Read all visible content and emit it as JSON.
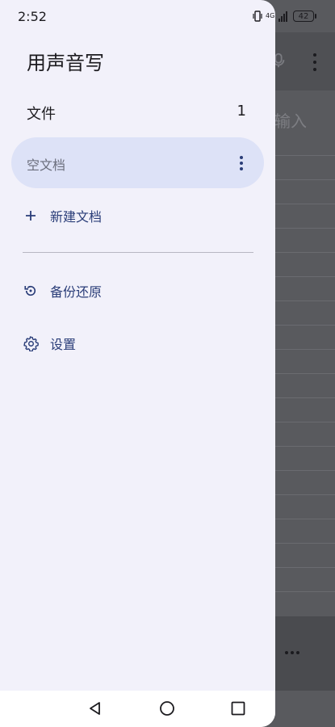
{
  "status_bar": {
    "time": "2:52",
    "battery": "42",
    "network": "4G"
  },
  "background_app": {
    "input_placeholder_fragment": "输入"
  },
  "drawer": {
    "app_title": "用声音写",
    "files_label": "文件",
    "files_count": "1",
    "documents": [
      {
        "label": "空文档"
      }
    ],
    "new_document_label": "新建文档",
    "backup_restore_label": "备份还原",
    "settings_label": "设置"
  },
  "icons": {
    "new_document": "plus-icon",
    "backup_restore": "restore-icon",
    "settings": "gear-icon",
    "document_menu": "more-vert-icon",
    "nav_back": "back-triangle-icon",
    "nav_home": "home-circle-icon",
    "nav_recent": "recent-square-icon"
  },
  "colors": {
    "drawer_bg": "#f2f1fa",
    "selected_item_bg": "#dde2f7",
    "accent": "#2a3d78",
    "scrim": "#595a5e"
  }
}
